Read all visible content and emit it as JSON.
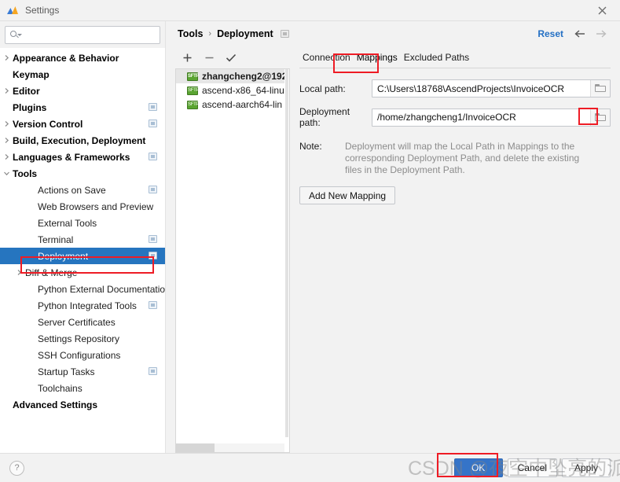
{
  "window": {
    "title": "Settings",
    "app_icon": "settings-app-icon",
    "close_icon": "close-icon"
  },
  "search": {
    "value": "",
    "placeholder": "",
    "icon": "search-icon"
  },
  "sidebar": {
    "items": [
      {
        "label": "Appearance & Behavior",
        "level": "top",
        "arrow": "chevron-right",
        "badge": false,
        "selected": false
      },
      {
        "label": "Keymap",
        "level": "top",
        "arrow": "none",
        "badge": false,
        "selected": false
      },
      {
        "label": "Editor",
        "level": "top",
        "arrow": "chevron-right",
        "badge": false,
        "selected": false
      },
      {
        "label": "Plugins",
        "level": "top",
        "arrow": "none",
        "badge": true,
        "selected": false
      },
      {
        "label": "Version Control",
        "level": "top",
        "arrow": "chevron-right",
        "badge": true,
        "selected": false
      },
      {
        "label": "Build, Execution, Deployment",
        "level": "top",
        "arrow": "chevron-right",
        "badge": false,
        "selected": false
      },
      {
        "label": "Languages & Frameworks",
        "level": "top",
        "arrow": "chevron-right",
        "badge": true,
        "selected": false
      },
      {
        "label": "Tools",
        "level": "top",
        "arrow": "chevron-down",
        "badge": false,
        "selected": false
      },
      {
        "label": "Actions on Save",
        "level": "child",
        "arrow": "none",
        "badge": true,
        "selected": false
      },
      {
        "label": "Web Browsers and Preview",
        "level": "child",
        "arrow": "none",
        "badge": false,
        "selected": false
      },
      {
        "label": "External Tools",
        "level": "child",
        "arrow": "none",
        "badge": false,
        "selected": false
      },
      {
        "label": "Terminal",
        "level": "child",
        "arrow": "none",
        "badge": true,
        "selected": false
      },
      {
        "label": "Deployment",
        "level": "child",
        "arrow": "none",
        "badge": true,
        "selected": true
      },
      {
        "label": "Diff & Merge",
        "level": "child",
        "arrow": "chevron-right",
        "badge": false,
        "selected": false
      },
      {
        "label": "Python External Documentation",
        "level": "child",
        "arrow": "none",
        "badge": false,
        "selected": false
      },
      {
        "label": "Python Integrated Tools",
        "level": "child",
        "arrow": "none",
        "badge": true,
        "selected": false
      },
      {
        "label": "Server Certificates",
        "level": "child",
        "arrow": "none",
        "badge": false,
        "selected": false
      },
      {
        "label": "Settings Repository",
        "level": "child",
        "arrow": "none",
        "badge": false,
        "selected": false
      },
      {
        "label": "SSH Configurations",
        "level": "child",
        "arrow": "none",
        "badge": false,
        "selected": false
      },
      {
        "label": "Startup Tasks",
        "level": "child",
        "arrow": "none",
        "badge": true,
        "selected": false
      },
      {
        "label": "Toolchains",
        "level": "child",
        "arrow": "none",
        "badge": false,
        "selected": false
      },
      {
        "label": "Advanced Settings",
        "level": "top",
        "arrow": "none",
        "badge": false,
        "selected": false
      }
    ]
  },
  "breadcrumb": {
    "root": "Tools",
    "separator": "›",
    "current": "Deployment",
    "badge_icon": "settings-badge-icon"
  },
  "header": {
    "reset_label": "Reset",
    "back_icon": "arrow-left-icon",
    "forward_icon": "arrow-right-icon"
  },
  "server_panel": {
    "toolbar": [
      {
        "name": "add-server-button",
        "glyph": "+"
      },
      {
        "name": "remove-server-button",
        "glyph": "−"
      },
      {
        "name": "set-default-server-button",
        "glyph": "✓"
      }
    ],
    "items": [
      {
        "label": "zhangcheng2@192",
        "badge": "SFTP",
        "selected": true
      },
      {
        "label": "ascend-x86_64-linu",
        "badge": "SFTP",
        "selected": false
      },
      {
        "label": "ascend-aarch64-lin",
        "badge": "SFTP",
        "selected": false
      }
    ]
  },
  "tabs": [
    {
      "label": "Connection",
      "active": false
    },
    {
      "label": "Mappings",
      "active": true
    },
    {
      "label": "Excluded Paths",
      "active": false
    }
  ],
  "mappings_form": {
    "local_path": {
      "label": "Local path:",
      "value": "C:\\Users\\18768\\AscendProjects\\InvoiceOCR",
      "placeholder": "",
      "browse_icon": "folder-icon"
    },
    "deployment_path": {
      "label": "Deployment path:",
      "value": "/home/zhangcheng1/InvoiceOCR",
      "placeholder": "",
      "browse_icon": "folder-icon"
    },
    "note_label": "Note:",
    "note_text": "Deployment will map the Local Path in Mappings to the corresponding Deployment Path, and delete the existing files in the Deployment Path.",
    "add_mapping_label": "Add New Mapping"
  },
  "footer": {
    "help_label": "?",
    "buttons": [
      {
        "label": "OK",
        "primary": true
      },
      {
        "label": "Cancel",
        "primary": false
      },
      {
        "label": "Apply",
        "primary": false
      }
    ]
  },
  "watermark": {
    "text": "CSDN @夜空中坠亮的派大星"
  },
  "annotations": {
    "accent_red": "#ee1c25",
    "selection_blue": "#2675bf",
    "primary_button_blue": "#3574c8",
    "link_blue": "#2470c4"
  }
}
